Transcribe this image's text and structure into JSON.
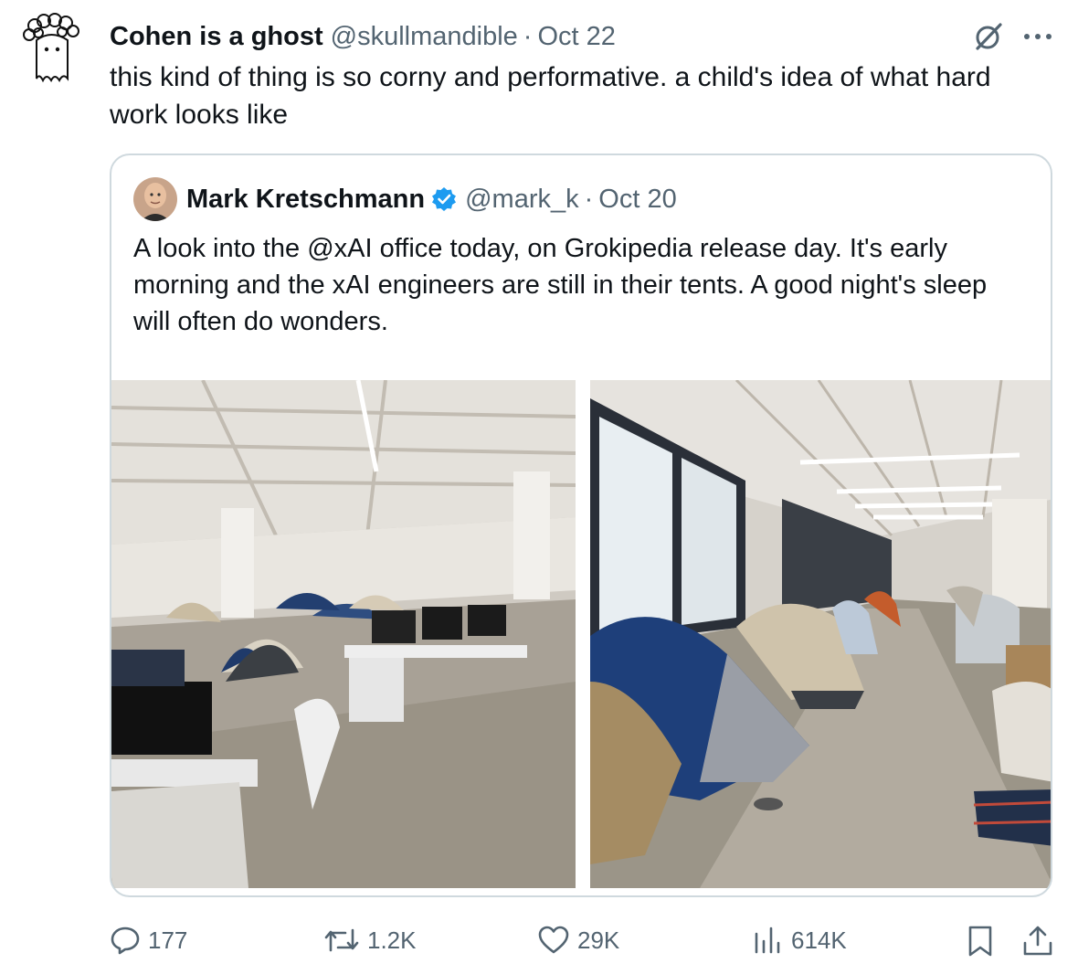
{
  "tweet": {
    "author_name": "Cohen is a ghost",
    "author_handle": "@skullmandible",
    "separator": "·",
    "date": "Oct 22",
    "text": "this kind of thing is so corny and performative. a child's idea of what hard work looks like"
  },
  "quoted": {
    "author_name": "Mark Kretschmann",
    "author_handle": "@mark_k",
    "separator": "·",
    "date": "Oct 20",
    "verified": true,
    "text": "A look into the @xAI office today, on Grokipedia release day. It's early morning and the xAI engineers are still in their tents. A good night's sleep will often do wonders."
  },
  "actions": {
    "replies": "177",
    "reposts": "1.2K",
    "likes": "29K",
    "views": "614K"
  },
  "icons": [
    "ghost-avatar-icon",
    "grok-icon",
    "more-icon",
    "verified-badge-icon",
    "reply-icon",
    "repost-icon",
    "like-icon",
    "views-icon",
    "bookmark-icon",
    "share-icon"
  ],
  "colors": {
    "text": "#0f1419",
    "secondary": "#536471",
    "border": "#cfd9de",
    "verified": "#1d9bf0"
  }
}
